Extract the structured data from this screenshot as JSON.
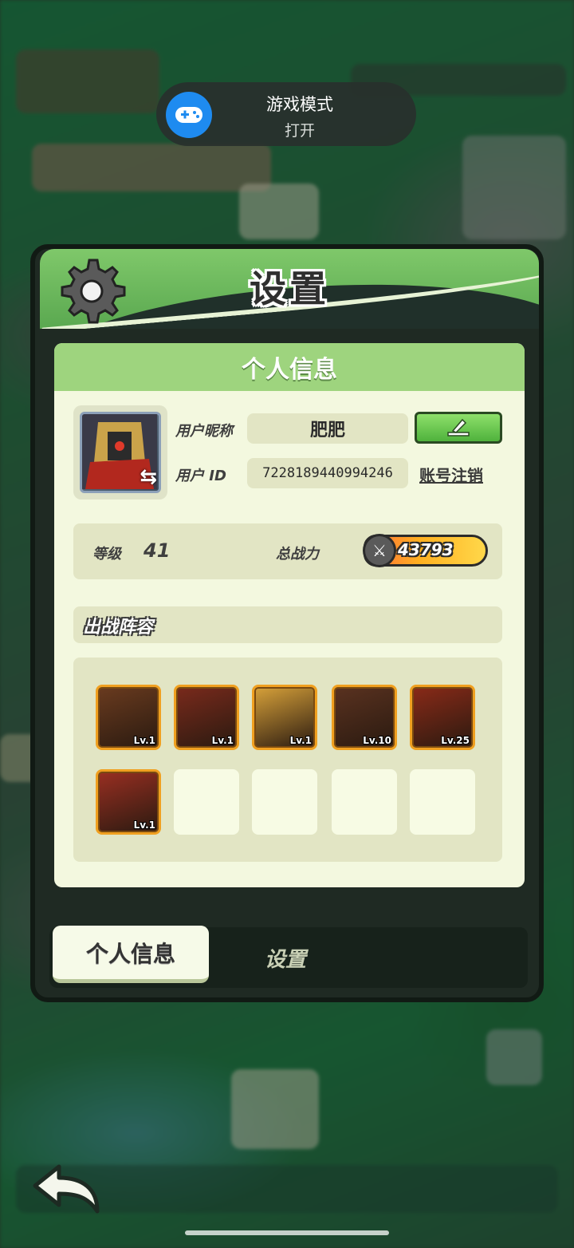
{
  "toast": {
    "title": "游戏模式",
    "status": "打开"
  },
  "panel": {
    "title": "设置"
  },
  "profile": {
    "section_title": "个人信息",
    "nickname_label": "用户昵称",
    "nickname": "肥肥",
    "id_label": "用户 ID",
    "user_id": "7228189440994246",
    "cancel_account": "账号注销",
    "level_label": "等级",
    "level": "41",
    "power_label": "总战力",
    "power": "43793",
    "lineup_title": "出战阵容",
    "heroes": [
      {
        "lv": "Lv.1",
        "color": "#6a3b1f"
      },
      {
        "lv": "Lv.1",
        "color": "#7a2a1c"
      },
      {
        "lv": "Lv.1",
        "color": "#d8a23a"
      },
      {
        "lv": "Lv.10",
        "color": "#5a3220"
      },
      {
        "lv": "Lv.25",
        "color": "#8a2a18"
      },
      {
        "lv": "Lv.1",
        "color": "#9a2f22"
      }
    ]
  },
  "tabs": {
    "personal": "个人信息",
    "settings": "设置"
  },
  "colors": {
    "accent_green": "#5aa850",
    "edit_button": "#4fb23c",
    "toast_icon": "#1e8bf0"
  }
}
